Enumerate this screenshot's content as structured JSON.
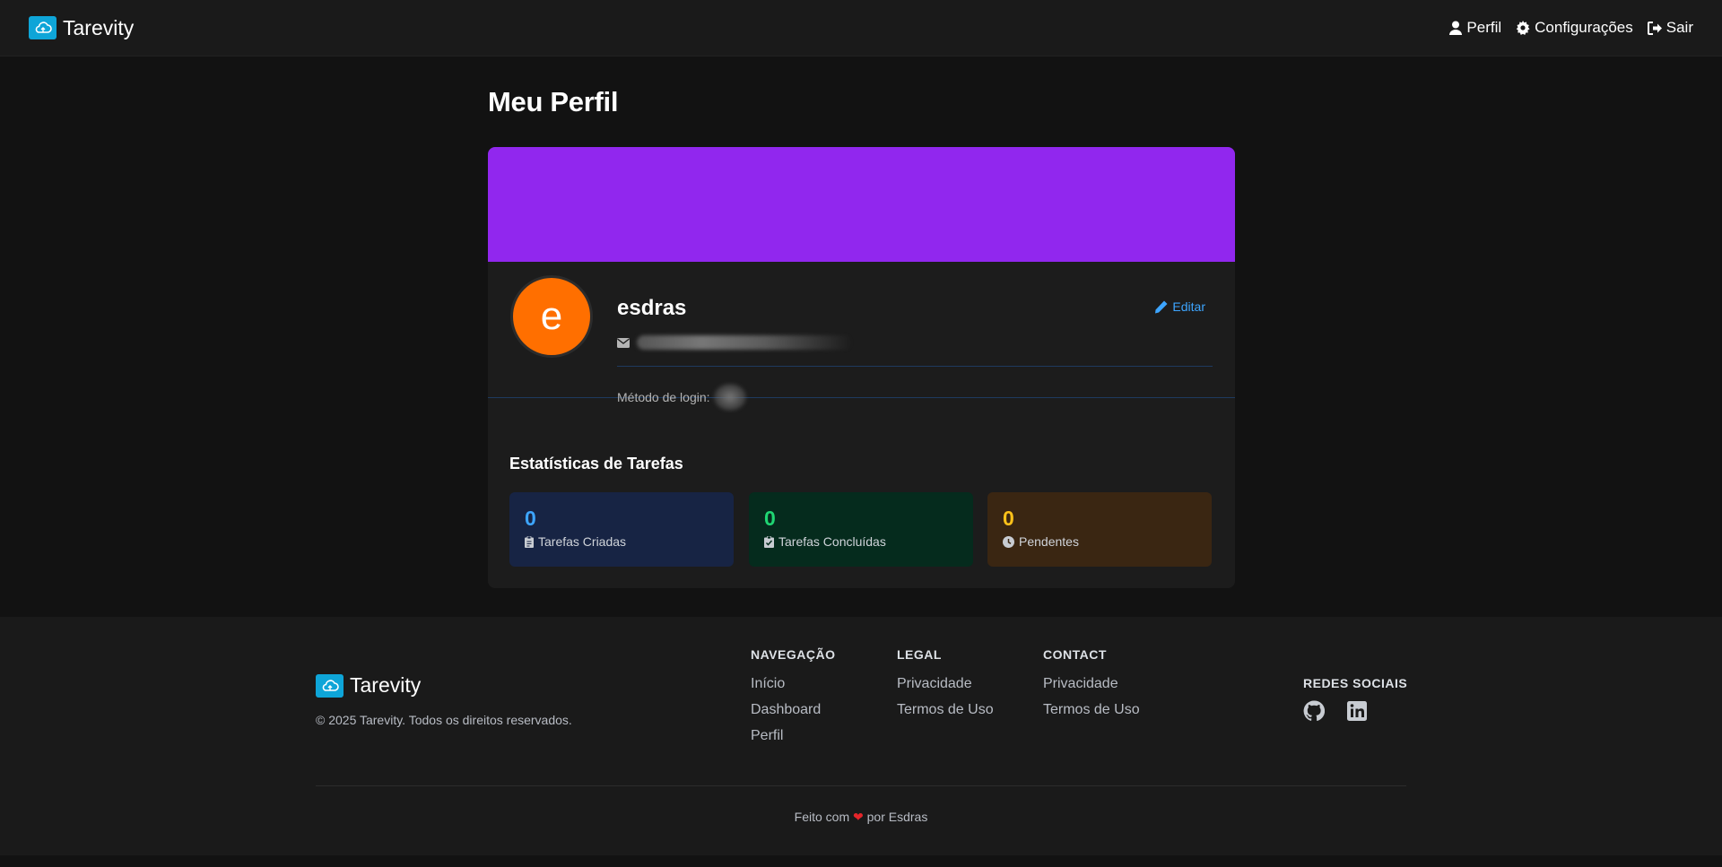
{
  "header": {
    "brand": "Tarevity",
    "nav": [
      {
        "label": "Perfil",
        "icon": "user-icon"
      },
      {
        "label": "Configurações",
        "icon": "gear-icon"
      },
      {
        "label": "Sair",
        "icon": "sign-out-icon"
      }
    ]
  },
  "page": {
    "title": "Meu Perfil"
  },
  "profile": {
    "avatar_letter": "e",
    "name": "esdras",
    "edit_label": "Editar",
    "login_method_label": "Método de login:"
  },
  "stats": {
    "title": "Estatísticas de Tarefas",
    "items": [
      {
        "value": "0",
        "label": "Tarefas Criadas",
        "icon": "clipboard-icon"
      },
      {
        "value": "0",
        "label": "Tarefas Concluídas",
        "icon": "check-square-icon"
      },
      {
        "value": "0",
        "label": "Pendentes",
        "icon": "clock-icon"
      }
    ]
  },
  "footer": {
    "brand": "Tarevity",
    "copyright": "© 2025 Tarevity. Todos os direitos reservados.",
    "columns": [
      {
        "title": "NAVEGAÇÃO",
        "links": [
          "Início",
          "Dashboard",
          "Perfil"
        ]
      },
      {
        "title": "LEGAL",
        "links": [
          "Privacidade",
          "Termos de Uso"
        ]
      },
      {
        "title": "CONTACT",
        "links": [
          "Privacidade",
          "Termos de Uso"
        ]
      }
    ],
    "social_title": "REDES SOCIAIS",
    "made_prefix": "Feito com",
    "made_suffix": "por Esdras"
  },
  "colors": {
    "banner": "#9127ee",
    "avatar": "#ff6f00",
    "accent": "#3da5ff",
    "stat_created": "#3da5ff",
    "stat_done": "#1fd673",
    "stat_pending": "#ffc21a"
  }
}
